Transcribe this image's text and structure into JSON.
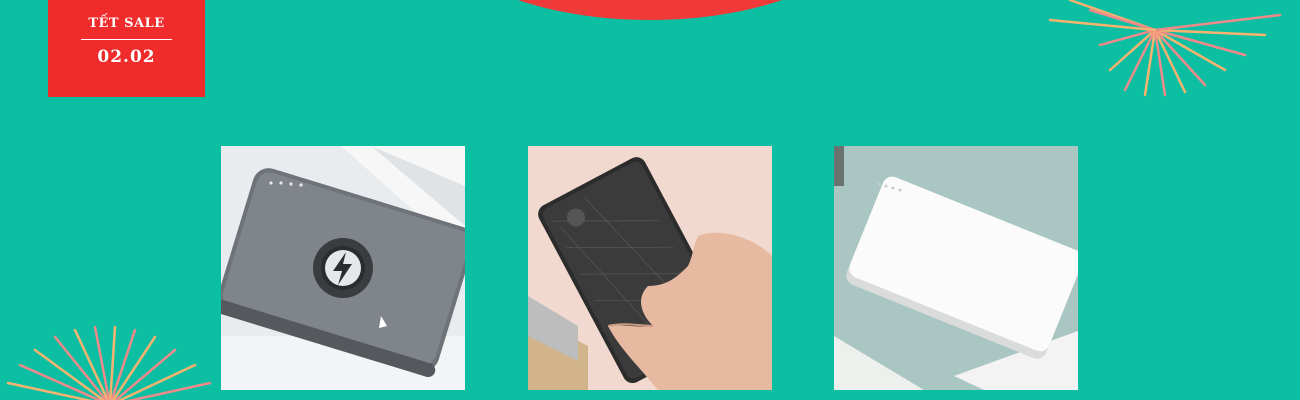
{
  "badge": {
    "title": "TẾT SALE",
    "date": "02.02"
  },
  "colors": {
    "background": "#0dbfa2",
    "accent_red": "#ef2b2b"
  },
  "products": [
    {
      "icon": "wireless-charging-power-bank-image"
    },
    {
      "icon": "fabric-power-bank-in-hand-image"
    },
    {
      "icon": "white-power-bank-image"
    }
  ]
}
